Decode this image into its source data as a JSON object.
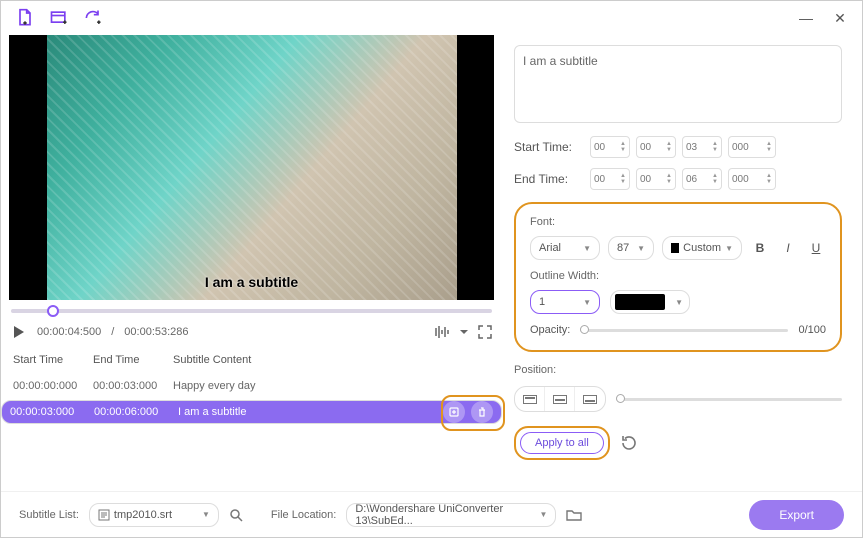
{
  "subtitle_text": "I am a subtitle",
  "overlay_text": "I am a subtitle",
  "time": {
    "start_label": "Start Time:",
    "end_label": "End Time:",
    "start": {
      "h": "00",
      "m": "00",
      "s": "03",
      "ms": "000"
    },
    "end": {
      "h": "00",
      "m": "00",
      "s": "06",
      "ms": "000"
    }
  },
  "playback": {
    "current": "00:00:04:500",
    "total": "00:00:53:286"
  },
  "font_panel": {
    "font_label": "Font:",
    "font_name": "Arial",
    "font_size": "87",
    "color_mode": "Custom",
    "color_swatch": "#000000",
    "outline_label": "Outline Width:",
    "outline_width": "1",
    "outline_color": "#000000",
    "opacity_label": "Opacity:",
    "opacity_value": "0/100"
  },
  "position_label": "Position:",
  "apply_label": "Apply to all",
  "table": {
    "headers": {
      "start": "Start Time",
      "end": "End Time",
      "content": "Subtitle Content"
    },
    "rows": [
      {
        "start": "00:00:00:000",
        "end": "00:00:03:000",
        "content": "Happy every day"
      },
      {
        "start": "00:00:03:000",
        "end": "00:00:06:000",
        "content": "I am a subtitle"
      }
    ]
  },
  "bottom": {
    "subtitle_list_label": "Subtitle List:",
    "subtitle_file": "tmp2010.srt",
    "file_location_label": "File Location:",
    "file_location": "D:\\Wondershare UniConverter 13\\SubEd...",
    "export_label": "Export"
  }
}
